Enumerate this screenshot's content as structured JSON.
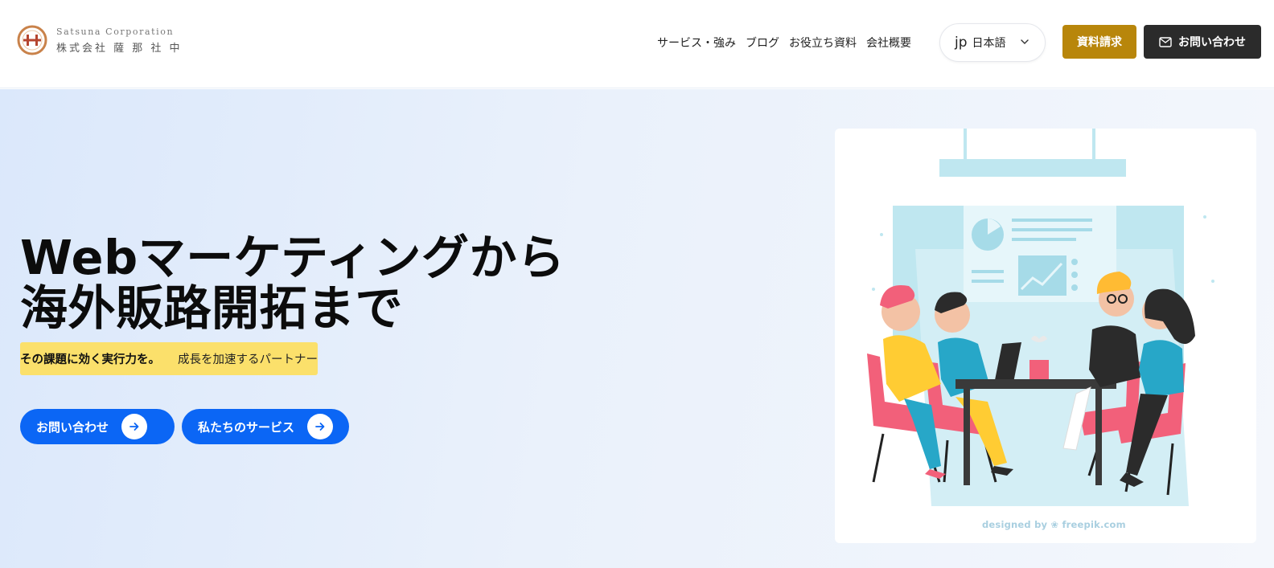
{
  "brand": {
    "name_en": "Satsuna Corporation",
    "name_ja": "株式会社 薩 那 社 中"
  },
  "nav": {
    "items": [
      "サービス・強み",
      "ブログ",
      "お役立ち資料",
      "会社概要"
    ]
  },
  "language": {
    "code": "jp",
    "label": "日本語"
  },
  "header_buttons": {
    "documents": "資料請求",
    "contact": "お問い合わせ"
  },
  "hero": {
    "title_line1": "Webマーケティングから",
    "title_line2": "海外販路開拓まで",
    "tagline_strong": "その課題に効く実行力を。",
    "tagline_soft": "成長を加速するパートナー",
    "cta_contact": "お問い合わせ",
    "cta_services": "私たちのサービス"
  },
  "illustration": {
    "credit": "designed by ❀ freepik.com"
  },
  "colors": {
    "gold": "#b8860b",
    "dark": "#2b2b2b",
    "primary_blue": "#0b66f5",
    "highlight_yellow": "#fbe06b"
  }
}
